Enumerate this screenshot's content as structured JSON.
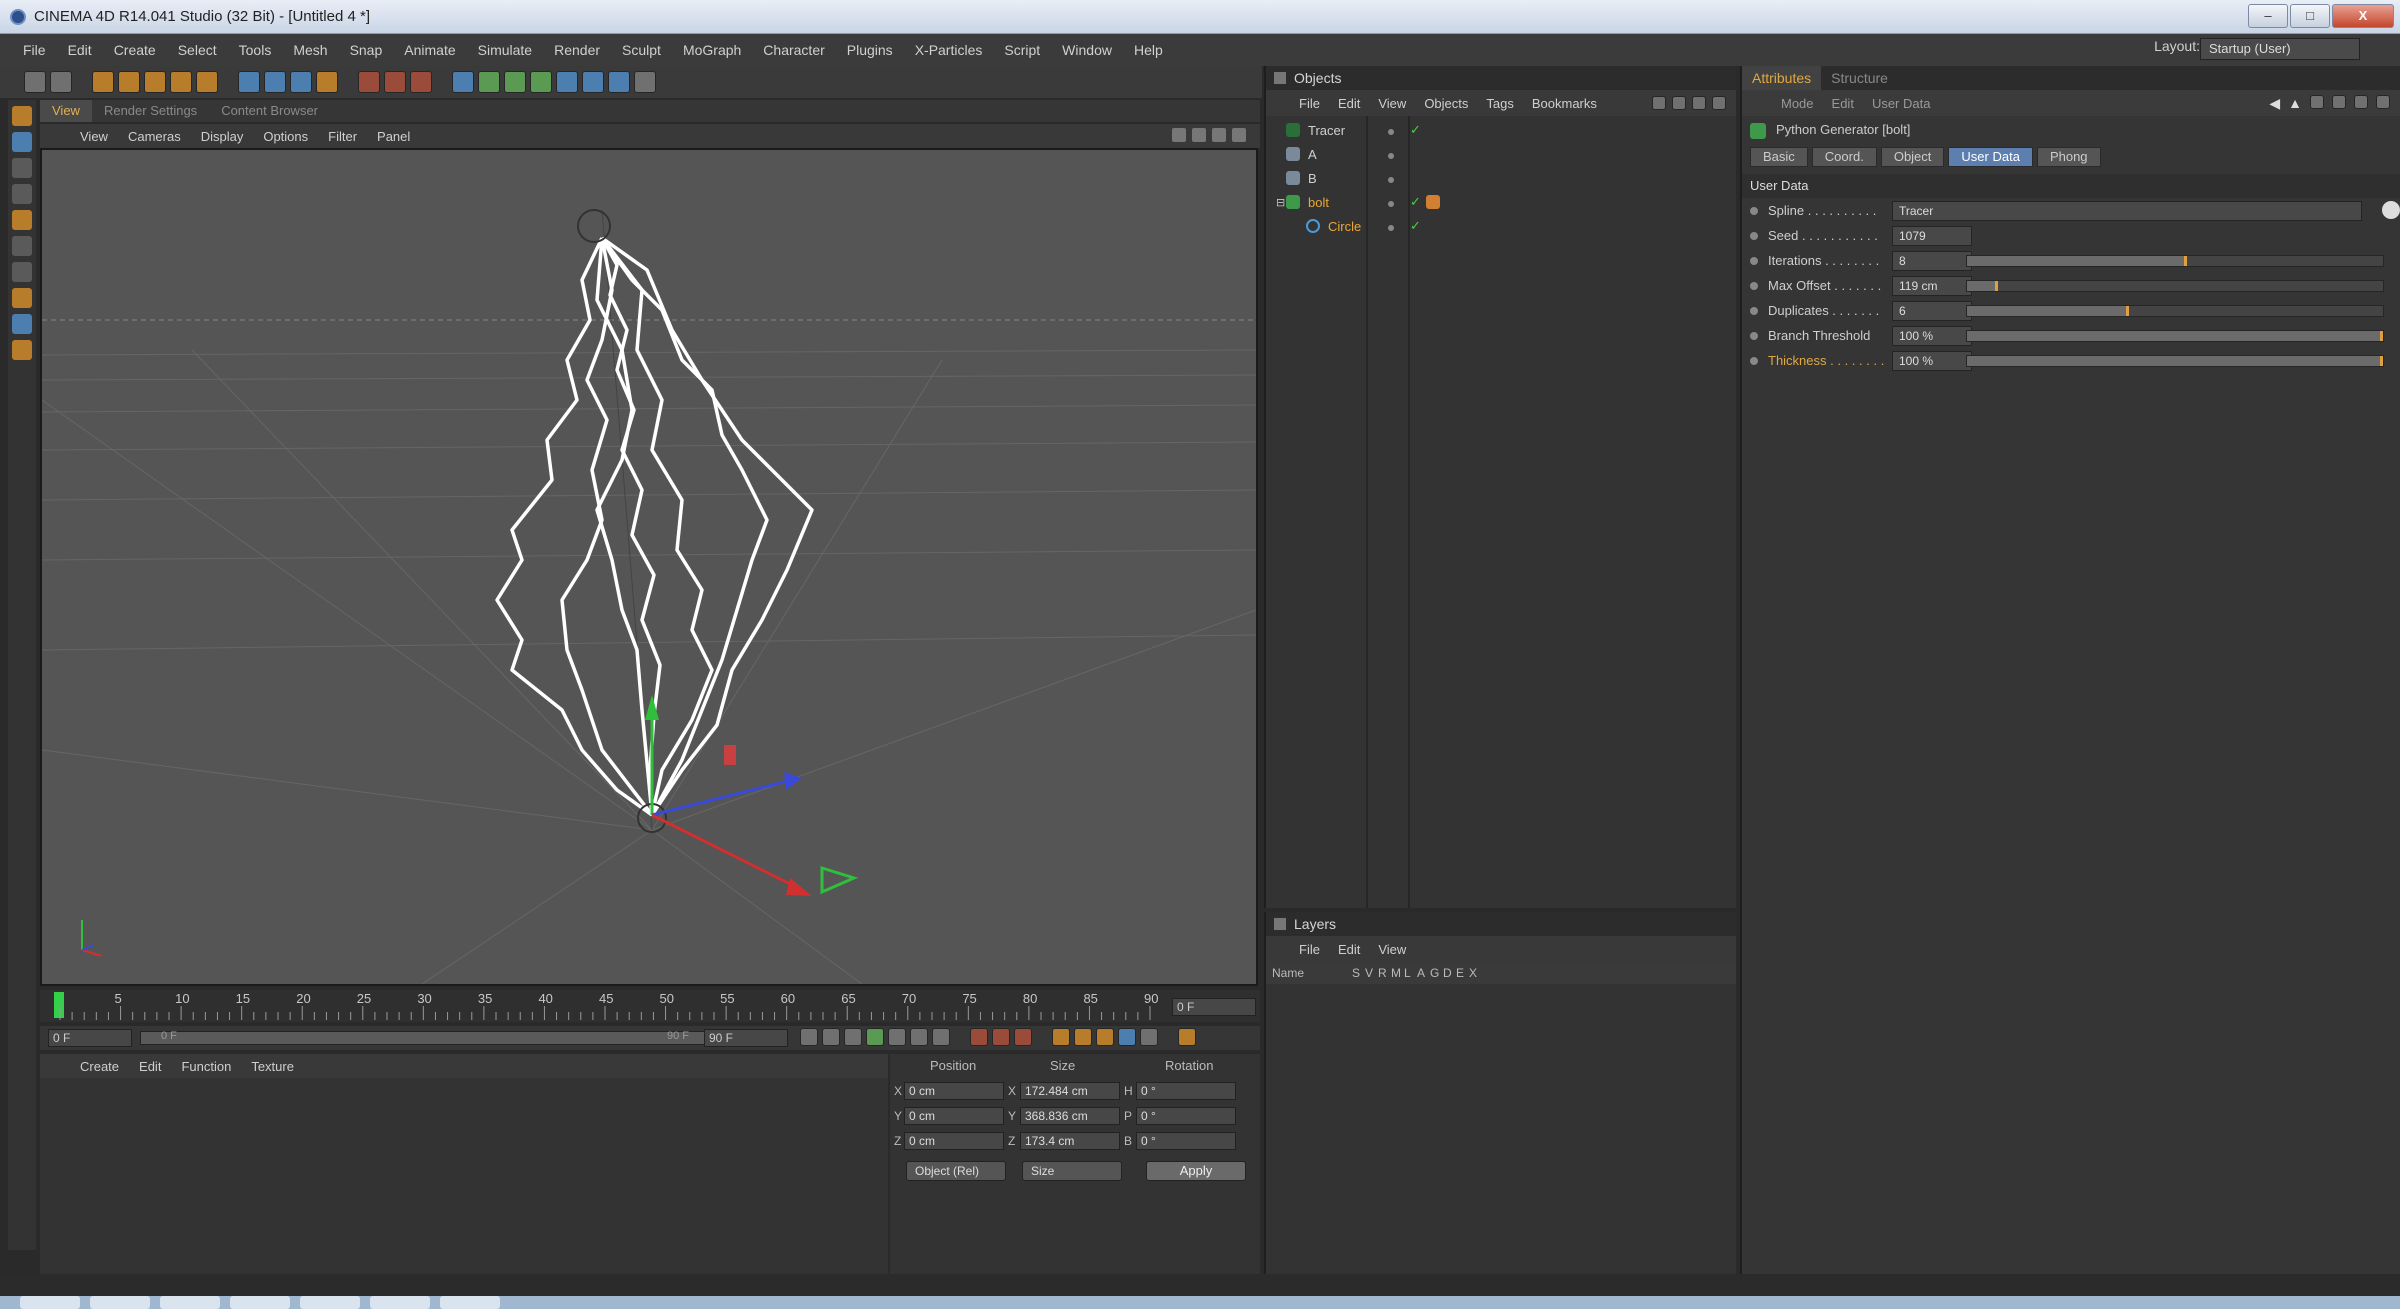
{
  "window": {
    "title": "CINEMA 4D R14.041 Studio (32 Bit) - [Untitled 4 *]",
    "minimize": "–",
    "maximize": "□",
    "close": "X"
  },
  "menubar": [
    "File",
    "Edit",
    "Create",
    "Select",
    "Tools",
    "Mesh",
    "Snap",
    "Animate",
    "Simulate",
    "Render",
    "Sculpt",
    "MoGraph",
    "Character",
    "Plugins",
    "X-Particles",
    "Script",
    "Window",
    "Help"
  ],
  "layout": {
    "label": "Layout:",
    "value": "Startup (User)"
  },
  "viewport": {
    "tabs": [
      "View",
      "Render Settings",
      "Content Browser"
    ],
    "menu": [
      "View",
      "Cameras",
      "Display",
      "Options",
      "Filter",
      "Panel"
    ]
  },
  "timeline": {
    "ticks": [
      "0",
      "5",
      "10",
      "15",
      "20",
      "25",
      "30",
      "35",
      "40",
      "45",
      "50",
      "55",
      "60",
      "65",
      "70",
      "75",
      "80",
      "85",
      "90"
    ],
    "current_frame": "0 F",
    "start_frame": "0 F",
    "range_start": "0 F",
    "range_end": "90 F",
    "end_frame": "90 F"
  },
  "material_menu": [
    "Create",
    "Edit",
    "Function",
    "Texture"
  ],
  "coordinates": {
    "headers": [
      "Position",
      "Size",
      "Rotation"
    ],
    "rows": [
      {
        "axis": "X",
        "pos": "0 cm",
        "size_axis": "X",
        "size": "172.484 cm",
        "rot_axis": "H",
        "rot": "0 °"
      },
      {
        "axis": "Y",
        "pos": "0 cm",
        "size_axis": "Y",
        "size": "368.836 cm",
        "rot_axis": "P",
        "rot": "0 °"
      },
      {
        "axis": "Z",
        "pos": "0 cm",
        "size_axis": "Z",
        "size": "173.4 cm",
        "rot_axis": "B",
        "rot": "0 °"
      }
    ],
    "mode": "Object (Rel)",
    "size_mode": "Size",
    "apply": "Apply"
  },
  "objects": {
    "title": "Objects",
    "menu": [
      "File",
      "Edit",
      "View",
      "Objects",
      "Tags",
      "Bookmarks"
    ],
    "items": [
      {
        "name": "Tracer",
        "color": "#d0d0d0",
        "icon": "tracer-icon"
      },
      {
        "name": "A",
        "color": "#d0d0d0",
        "icon": "null-icon"
      },
      {
        "name": "B",
        "color": "#d0d0d0",
        "icon": "null-icon"
      },
      {
        "name": "bolt",
        "color": "#e8a838",
        "icon": "python-icon"
      },
      {
        "name": "Circle",
        "color": "#e8a838",
        "icon": "circle-spline-icon"
      }
    ]
  },
  "layers": {
    "title": "Layers",
    "menu": [
      "File",
      "Edit",
      "View"
    ],
    "columns": [
      "Name",
      "S",
      "V",
      "R",
      "M",
      "L",
      "A",
      "G",
      "D",
      "E",
      "X"
    ]
  },
  "attributes": {
    "tabs": [
      "Attributes",
      "Structure"
    ],
    "mode_menu": [
      "Mode",
      "Edit",
      "User Data"
    ],
    "object_title": "Python Generator [bolt]",
    "subtabs": [
      "Basic",
      "Coord.",
      "Object",
      "User Data",
      "Phong"
    ],
    "section": "User Data",
    "params": [
      {
        "label": "Spline . . . . . . . . . .",
        "value": "Tracer",
        "fill": null
      },
      {
        "label": "Seed . . . . . . . . . . .",
        "value": "1079",
        "fill": null
      },
      {
        "label": "Iterations . . . . . . . .",
        "value": "8",
        "fill": 0.53
      },
      {
        "label": "Max Offset . . . . . . .",
        "value": "119 cm",
        "fill": 0.075
      },
      {
        "label": "Duplicates . . . . . . .",
        "value": "6",
        "fill": 0.39
      },
      {
        "label": "Branch Threshold",
        "value": "100 %",
        "fill": 1.0
      },
      {
        "label": "Thickness . . . . . . . .",
        "value": "100 %",
        "fill": 1.0
      }
    ]
  },
  "colors": {
    "accent": "#e0a845",
    "selected_tab": "#5c7fb0",
    "viewport_bg": "#555555"
  }
}
